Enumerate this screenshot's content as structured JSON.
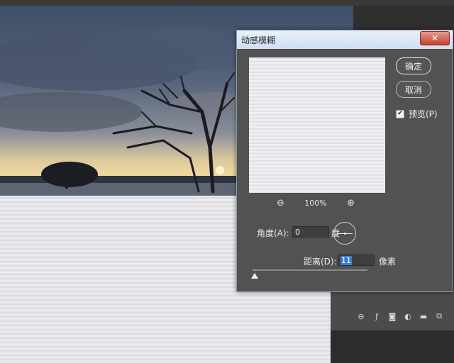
{
  "dialog": {
    "title": "动感模糊",
    "close_glyph": "✕",
    "ok_label": "确定",
    "cancel_label": "取消",
    "preview_label": "预览(P)",
    "preview_checked": true,
    "zoom_level": "100%",
    "zoom_out_icon": "zoom-out-icon",
    "zoom_in_icon": "zoom-in-icon",
    "angle_label": "角度(A):",
    "angle_value": "0",
    "angle_unit": "度",
    "distance_label": "距离(D):",
    "distance_value": "11",
    "distance_unit": "像素",
    "distance_slider_fraction": 0.02
  },
  "panel": {
    "icons": [
      "link-icon",
      "fx-icon",
      "mask-icon",
      "adjustment-icon",
      "folder-icon",
      "new-layer-icon"
    ]
  },
  "colors": {
    "dialog_bg": "#525252",
    "title_bar": "#dbe7f4",
    "close_button": "#c8442f",
    "selection": "#3b7fd8"
  }
}
